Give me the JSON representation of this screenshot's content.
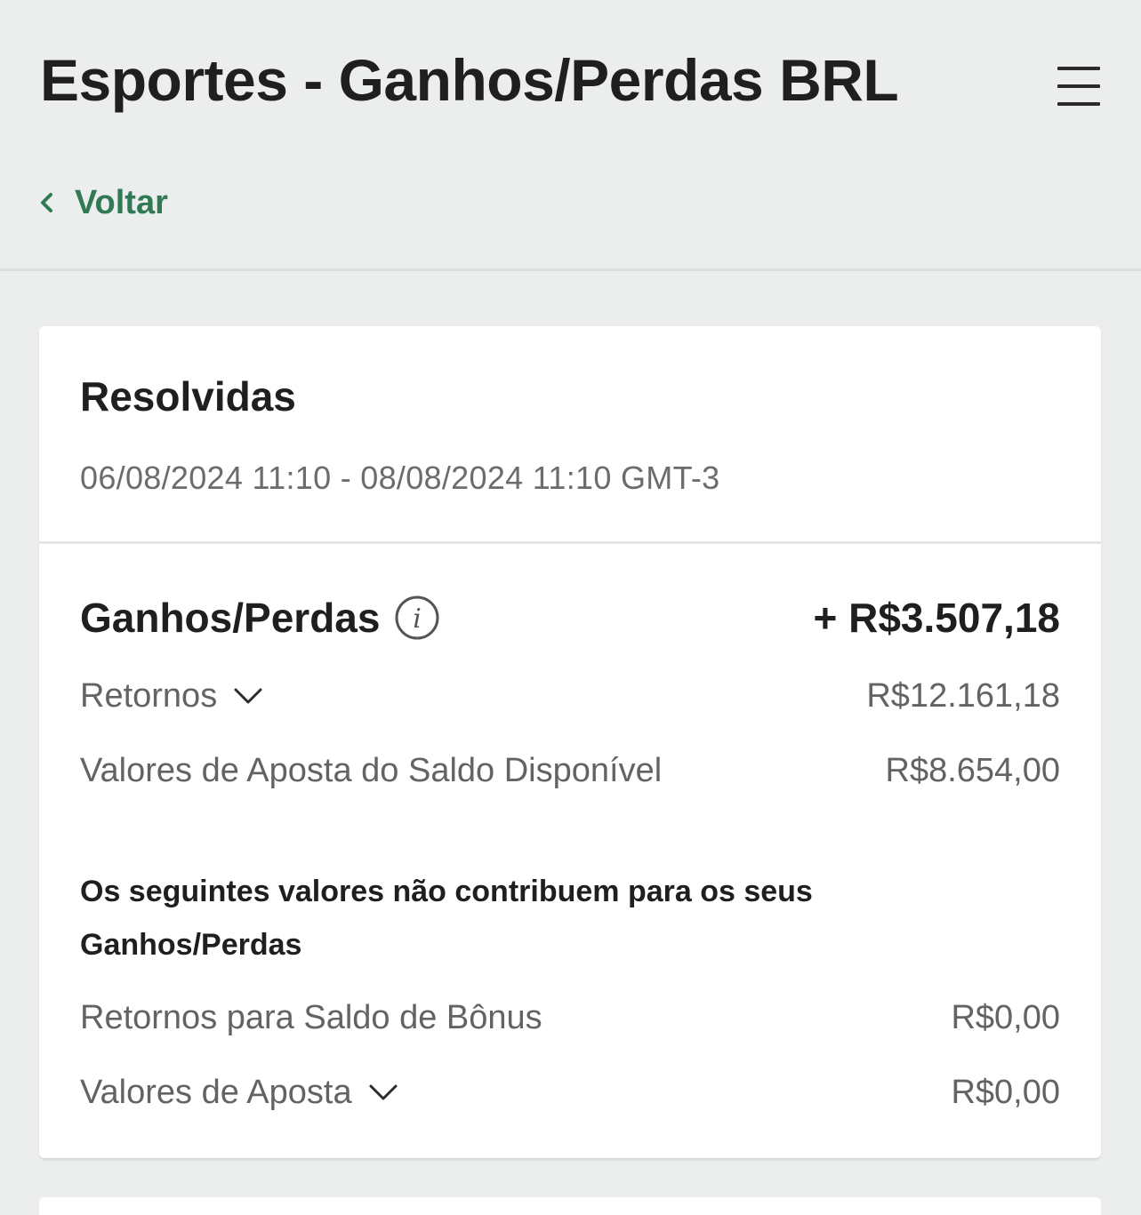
{
  "header": {
    "title": "Esportes - Ganhos/Perdas BRL",
    "menu_icon": "hamburger-menu-icon",
    "back_label": "Voltar",
    "back_icon": "chevron-left-icon"
  },
  "card": {
    "title": "Resolvidas",
    "date_range": "06/08/2024 11:10 - 08/08/2024 11:10 GMT-3",
    "total": {
      "label": "Ganhos/Perdas",
      "info_icon": "info-icon",
      "value": "+ R$3.507,18"
    },
    "lines": [
      {
        "label": "Retornos",
        "value": "R$12.161,18",
        "expandable": true
      },
      {
        "label": "Valores de Aposta do Saldo Disponível",
        "value": "R$8.654,00",
        "expandable": false
      }
    ],
    "note": "Os seguintes valores não contribuem para os seus Ganhos/Perdas",
    "extra_lines": [
      {
        "label": "Retornos para Saldo de Bônus",
        "value": "R$0,00",
        "expandable": false
      },
      {
        "label": "Valores de Aposta",
        "value": "R$0,00",
        "expandable": true
      }
    ]
  },
  "colors": {
    "background": "#eceeed",
    "card": "#ffffff",
    "accent_green": "#2f7a55",
    "text_primary": "#1f1f1f",
    "text_secondary": "#636363"
  }
}
